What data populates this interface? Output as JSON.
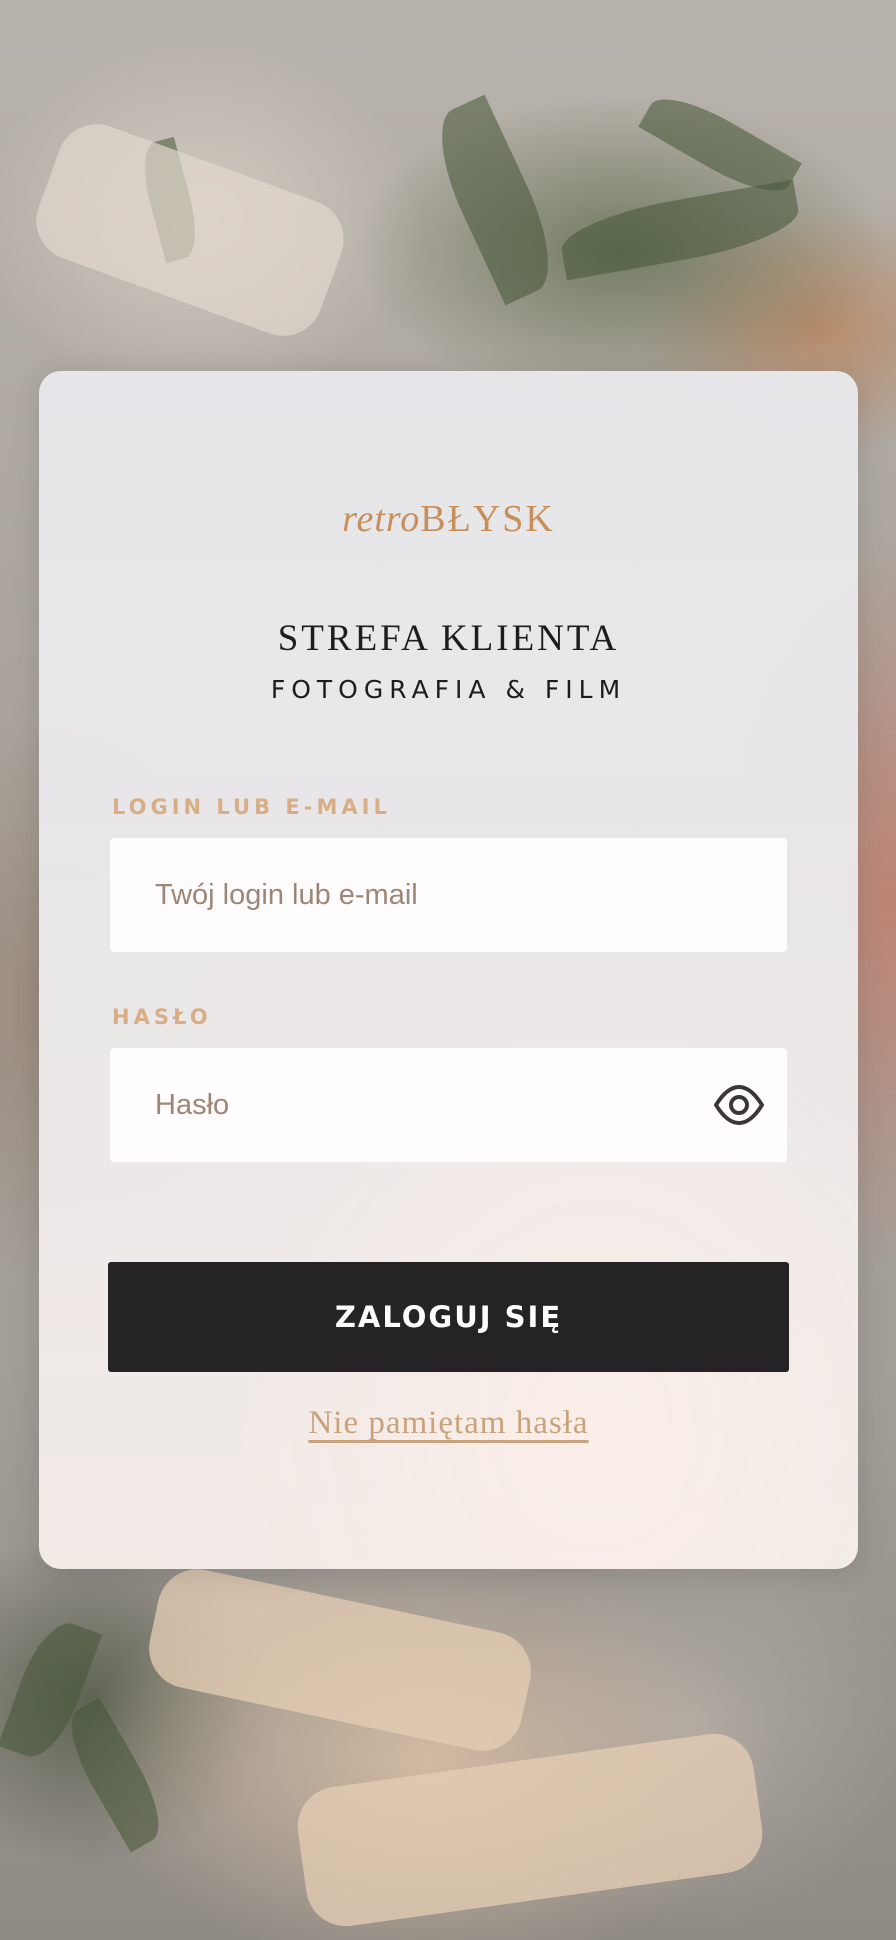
{
  "brand": {
    "logo_retro": "retro",
    "logo_blysk": "BŁYSK"
  },
  "header": {
    "title": "STREFA KLIENTA",
    "subtitle": "FOTOGRAFIA & FILM"
  },
  "form": {
    "login_label": "LOGIN LUB E-MAIL",
    "login_placeholder": "Twój login lub e-mail",
    "login_value": "",
    "password_label": "HASŁO",
    "password_placeholder": "Hasło",
    "password_value": "",
    "password_toggle_icon": "eye-icon",
    "submit_label": "ZALOGUJ SIĘ",
    "forgot_label": "Nie pamiętam hasła"
  },
  "colors": {
    "accent": "#c78f5a",
    "label": "#d7ae86",
    "button": "#252326",
    "text": "#1f1c1e"
  }
}
